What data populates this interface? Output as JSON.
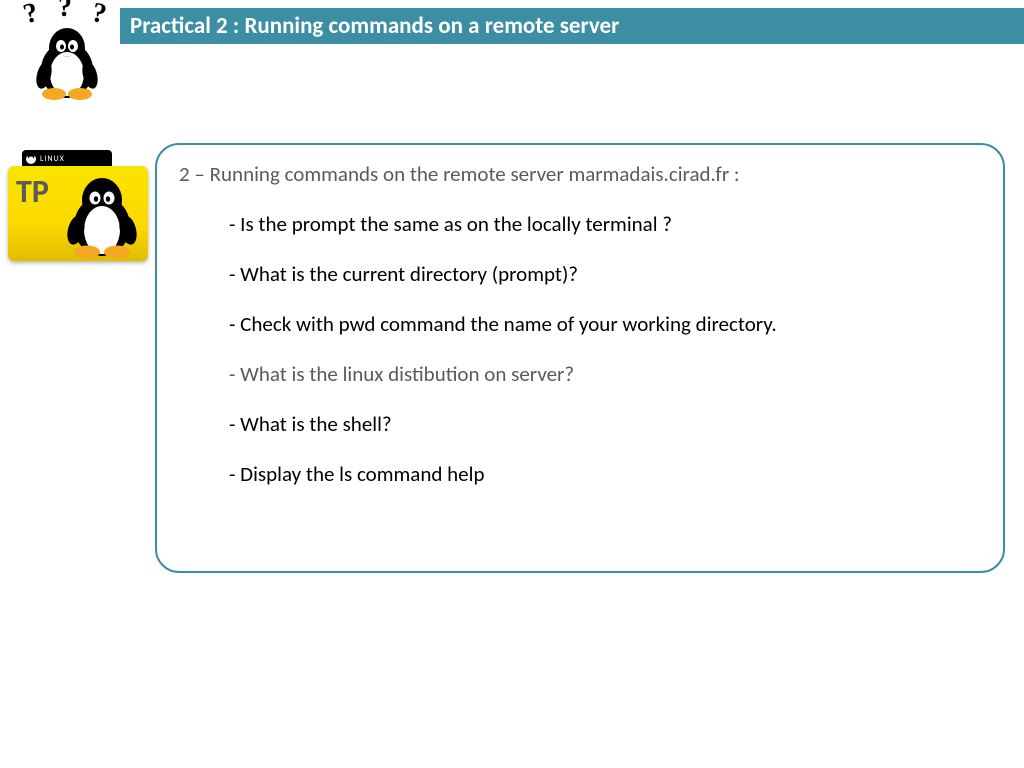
{
  "header": {
    "title": "Practical 2 : Running commands on a remote server"
  },
  "folder": {
    "tab_label": "LINUX",
    "badge": "TP"
  },
  "content": {
    "section_title": "2 – Running commands on the remote server marmadais.cirad.fr :",
    "questions": [
      {
        "text": "- Is the prompt the same as on the locally terminal ?",
        "muted": false
      },
      {
        "text": "- What is the current directory (prompt)?",
        "muted": false
      },
      {
        "text": "- Check with pwd command the name of your working directory.",
        "muted": false
      },
      {
        "text": "- What is the linux distibution on server?",
        "muted": true
      },
      {
        "text": "- What  is the shell?",
        "muted": false
      },
      {
        "text": "- Display the ls command help",
        "muted": false
      }
    ]
  }
}
